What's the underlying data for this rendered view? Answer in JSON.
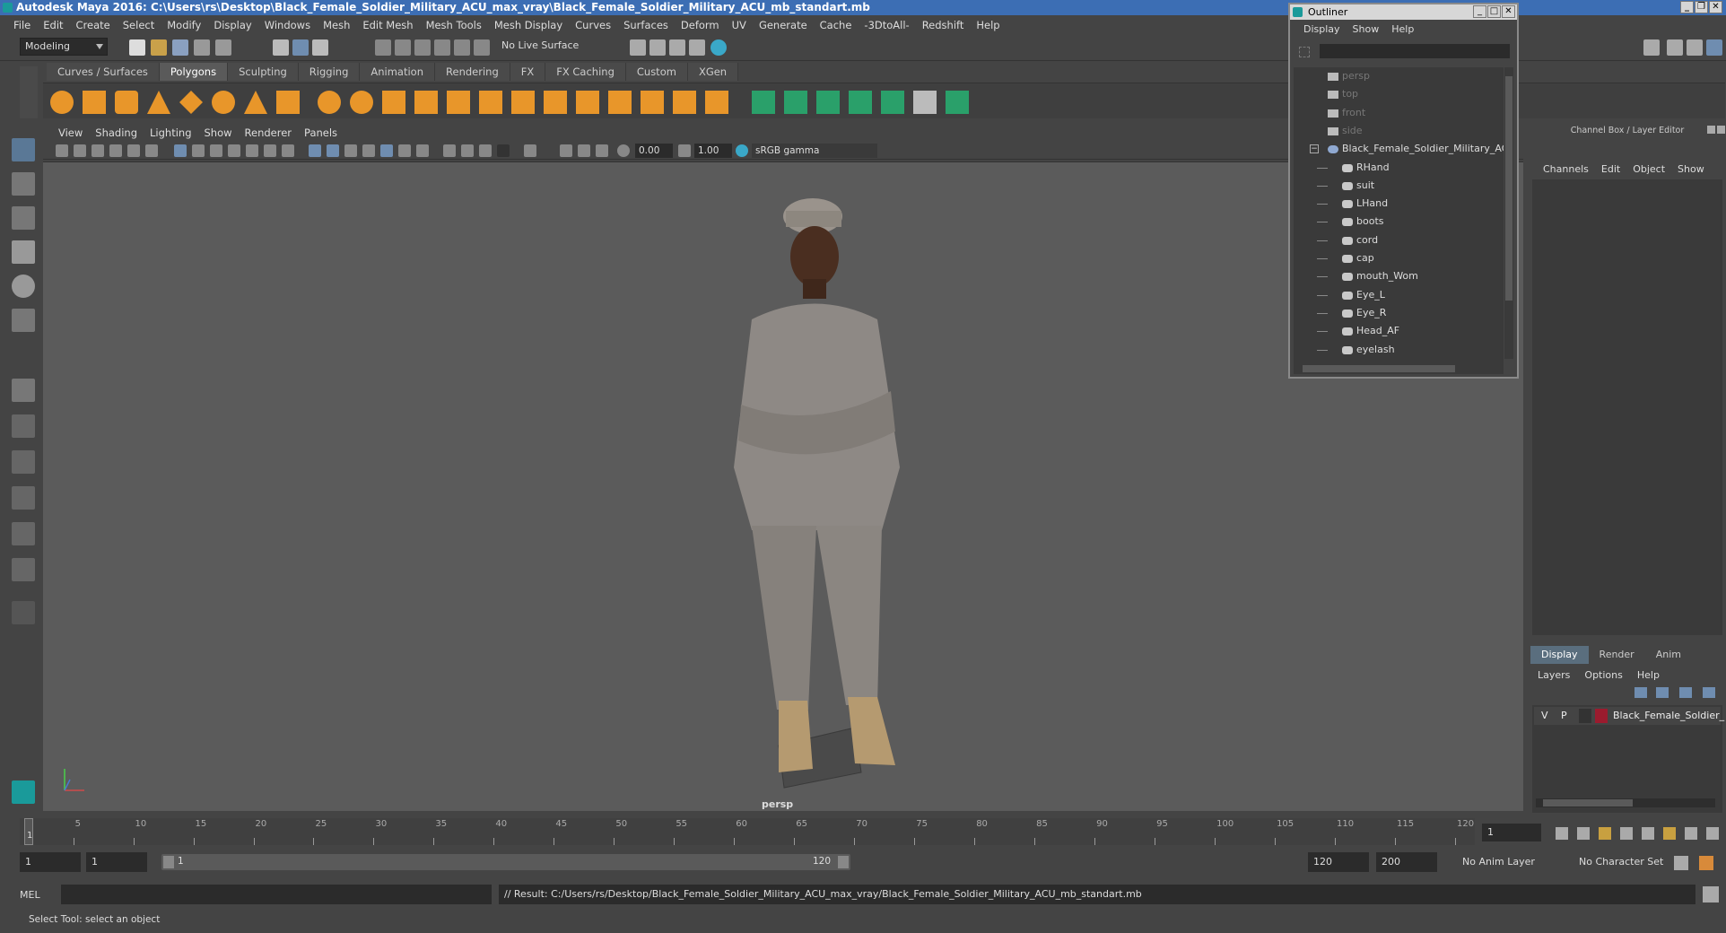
{
  "window": {
    "title": "Autodesk Maya 2016: C:\\Users\\rs\\Desktop\\Black_Female_Soldier_Military_ACU_max_vray\\Black_Female_Soldier_Military_ACU_mb_standart.mb"
  },
  "menubar": [
    "File",
    "Edit",
    "Create",
    "Select",
    "Modify",
    "Display",
    "Windows",
    "Mesh",
    "Edit Mesh",
    "Mesh Tools",
    "Mesh Display",
    "Curves",
    "Surfaces",
    "Deform",
    "UV",
    "Generate",
    "Cache",
    "-3DtoAll-",
    "Redshift",
    "Help"
  ],
  "statusline": {
    "mode": "Modeling",
    "live_surface": "No Live Surface"
  },
  "shelf": {
    "tabs": [
      "Curves / Surfaces",
      "Polygons",
      "Sculpting",
      "Rigging",
      "Animation",
      "Rendering",
      "FX",
      "FX Caching",
      "Custom",
      "XGen"
    ],
    "active_tab": "Polygons"
  },
  "viewport": {
    "menu": [
      "View",
      "Shading",
      "Lighting",
      "Show",
      "Renderer",
      "Panels"
    ],
    "exposure": "0.00",
    "gamma": "1.00",
    "color_space": "sRGB gamma",
    "camera_label": "persp"
  },
  "outliner": {
    "title": "Outliner",
    "menu": [
      "Display",
      "Show",
      "Help"
    ],
    "items": [
      {
        "label": "persp",
        "kind": "camera",
        "dim": true
      },
      {
        "label": "top",
        "kind": "camera",
        "dim": true
      },
      {
        "label": "front",
        "kind": "camera",
        "dim": true
      },
      {
        "label": "side",
        "kind": "camera",
        "dim": true
      },
      {
        "label": "Black_Female_Soldier_Military_AC",
        "kind": "group",
        "dim": false
      },
      {
        "label": "RHand",
        "kind": "mesh",
        "dim": false
      },
      {
        "label": "suit",
        "kind": "mesh",
        "dim": false
      },
      {
        "label": "LHand",
        "kind": "mesh",
        "dim": false
      },
      {
        "label": "boots",
        "kind": "mesh",
        "dim": false
      },
      {
        "label": "cord",
        "kind": "mesh",
        "dim": false
      },
      {
        "label": "cap",
        "kind": "mesh",
        "dim": false
      },
      {
        "label": "mouth_Wom",
        "kind": "mesh",
        "dim": false
      },
      {
        "label": "Eye_L",
        "kind": "mesh",
        "dim": false
      },
      {
        "label": "Eye_R",
        "kind": "mesh",
        "dim": false
      },
      {
        "label": "Head_AF",
        "kind": "mesh",
        "dim": false
      },
      {
        "label": "eyelash",
        "kind": "mesh",
        "dim": false
      }
    ]
  },
  "channelbox": {
    "title": "Channel Box / Layer Editor",
    "menu": [
      "Channels",
      "Edit",
      "Object",
      "Show"
    ]
  },
  "layer_editor": {
    "tabs": [
      "Display",
      "Render",
      "Anim"
    ],
    "active_tab": "Display",
    "menu": [
      "Layers",
      "Options",
      "Help"
    ],
    "layer": {
      "v": "V",
      "p": "P",
      "name": "Black_Female_Soldier_",
      "color": "#9b1b2e"
    }
  },
  "timeline": {
    "ticks": [
      "5",
      "10",
      "15",
      "20",
      "25",
      "30",
      "35",
      "40",
      "45",
      "50",
      "55",
      "60",
      "65",
      "70",
      "75",
      "80",
      "85",
      "90",
      "95",
      "100",
      "105",
      "110",
      "115",
      "120"
    ],
    "start_label": "1",
    "current_frame": "1"
  },
  "range": {
    "start": "1",
    "anim_start": "1",
    "range_start_label": "1",
    "range_end_label": "120",
    "anim_end": "120",
    "end": "200",
    "anim_layer": "No Anim Layer",
    "character_set": "No Character Set"
  },
  "commandline": {
    "lang": "MEL",
    "result": "// Result: C:/Users/rs/Desktop/Black_Female_Soldier_Military_ACU_max_vray/Black_Female_Soldier_Military_ACU_mb_standart.mb"
  },
  "helpline": "Select Tool: select an object",
  "colors": {
    "accent": "#5a6e7e",
    "title_bar": "#3c6eb4",
    "shelf_green": "#2aa06a",
    "shelf_orange": "#e8962a"
  }
}
